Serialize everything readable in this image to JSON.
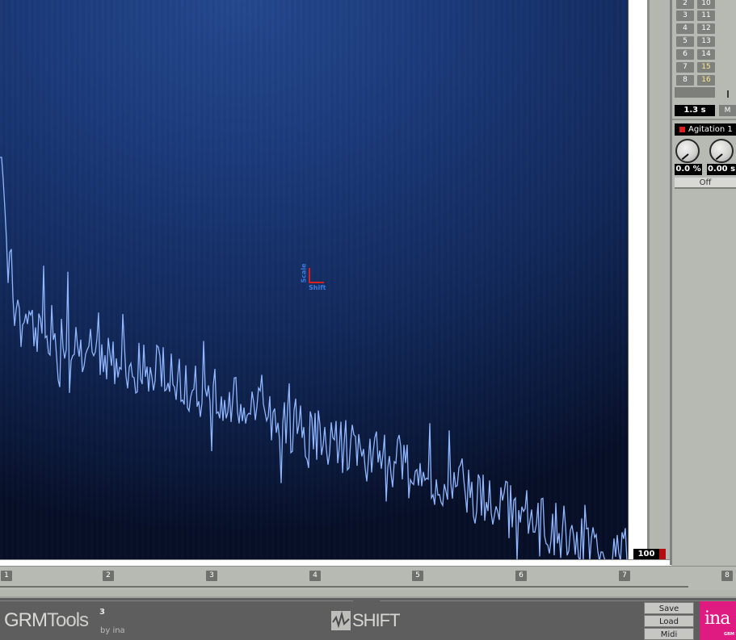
{
  "app": {
    "name": "GRM Tools SHIFT"
  },
  "display": {
    "gain_readout": "100 %"
  },
  "axis_indicator": {
    "vertical_label": "Scale",
    "horizontal_label": "Shift"
  },
  "channels": {
    "left": [
      "2",
      "3",
      "4",
      "5",
      "6",
      "7",
      "8"
    ],
    "right": [
      "10",
      "11",
      "12",
      "13",
      "14",
      "15",
      "16"
    ],
    "highlighted": [
      "15",
      "16"
    ]
  },
  "time": {
    "value": "1.3 s",
    "mode_label": "M"
  },
  "agitation": {
    "label": "Agitation 1",
    "led_color": "#e21d1d",
    "amount": "0.0 %",
    "time": "0.00 s",
    "state_label": "Off"
  },
  "timeline": {
    "markers": [
      "1",
      "2",
      "3",
      "4",
      "5",
      "6",
      "7",
      "8"
    ]
  },
  "footer": {
    "brand_grm": "GRM",
    "brand_tools": "Tools",
    "brand_version": "3",
    "brand_byline": "by ina",
    "plugin_name": "SHIFT",
    "buttons": {
      "save": "Save",
      "load": "Load",
      "midi": "Midi"
    },
    "logo_text": "ina",
    "logo_sub": "GRM"
  },
  "colors": {
    "spectrum_line": "#8fb6ff",
    "accent_red": "#d61f1f",
    "axis_label_blue": "#3a7be0",
    "ina_pink": "#df1b82"
  },
  "icons": {
    "plugin_logo": "waveform-check-icon",
    "knob": "rotary-knob-icon",
    "led": "status-led-icon"
  }
}
